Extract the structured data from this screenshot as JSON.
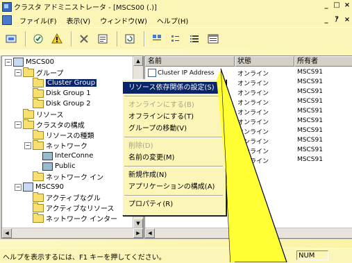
{
  "window": {
    "title": "クラスタ アドミニストレータ - [MSCS00 (.)]",
    "title_controls": [
      "_",
      "□",
      "×"
    ],
    "mdi_controls": [
      "_",
      "ｱ",
      "×"
    ]
  },
  "menubar": {
    "items": [
      "ファイル(F)",
      "表示(V)",
      "ウィンドウ(W)",
      "ヘルプ(H)"
    ]
  },
  "toolbar": {
    "buttons": [
      "connect-icon",
      "online-icon",
      "offline-icon",
      "delete-icon",
      "properties-icon",
      "refresh-icon",
      "large-icons-icon",
      "small-icons-icon",
      "list-view-icon",
      "details-view-icon"
    ]
  },
  "tree": {
    "items": [
      {
        "label": "MSCS00",
        "indent": 0,
        "icon": "cluster-icon",
        "expander": "−"
      },
      {
        "label": "グループ",
        "indent": 1,
        "icon": "folder-icon",
        "expander": "−"
      },
      {
        "label": "Cluster Group",
        "indent": 2,
        "icon": "folder-icon",
        "expander": "",
        "selected": true
      },
      {
        "label": "Disk Group 1",
        "indent": 2,
        "icon": "folder-icon",
        "expander": ""
      },
      {
        "label": "Disk Group 2",
        "indent": 2,
        "icon": "folder-icon",
        "expander": ""
      },
      {
        "label": "リソース",
        "indent": 1,
        "icon": "folder-icon",
        "expander": ""
      },
      {
        "label": "クラスタの構成",
        "indent": 1,
        "icon": "folder-icon",
        "expander": "−"
      },
      {
        "label": "リソースの種類",
        "indent": 2,
        "icon": "folder-icon",
        "expander": ""
      },
      {
        "label": "ネットワーク",
        "indent": 2,
        "icon": "folder-icon",
        "expander": "−"
      },
      {
        "label": "InterConne",
        "indent": 3,
        "icon": "network-icon",
        "expander": ""
      },
      {
        "label": "Public",
        "indent": 3,
        "icon": "network-icon",
        "expander": ""
      },
      {
        "label": "ネットワーク イン",
        "indent": 2,
        "icon": "folder-icon",
        "expander": ""
      },
      {
        "label": "MSCS90",
        "indent": 1,
        "icon": "server-icon",
        "expander": "−"
      },
      {
        "label": "アクティブなグル",
        "indent": 2,
        "icon": "folder-icon",
        "expander": ""
      },
      {
        "label": "アクティブなリソース",
        "indent": 2,
        "icon": "folder-icon",
        "expander": ""
      },
      {
        "label": "ネットワーク インター",
        "indent": 2,
        "icon": "folder-icon",
        "expander": ""
      }
    ]
  },
  "list": {
    "columns": [
      "名前",
      "状態",
      "所有者"
    ],
    "rows": [
      {
        "name": "Cluster IP Address",
        "state": "オンライン",
        "owner": "MSCS91"
      },
      {
        "name": "",
        "state": "オンライン",
        "owner": "MSCS91"
      },
      {
        "name": "",
        "state": "オンライン",
        "owner": "MSCS91"
      },
      {
        "name": "",
        "state": "オンライン",
        "owner": "MSCS91"
      },
      {
        "name": "",
        "state": "オンライン",
        "owner": "MSCS91"
      },
      {
        "name": "",
        "state": "オンライン",
        "owner": "MSCS91"
      },
      {
        "name": "",
        "state": "オンライン",
        "owner": "MSCS91"
      },
      {
        "name": "",
        "state": "オンライン",
        "owner": "MSCS91"
      },
      {
        "name": "",
        "state": "オンライン",
        "owner": "MSCS91"
      },
      {
        "name": "",
        "state": "オンライン",
        "owner": "MSCS91"
      }
    ]
  },
  "context_menu": {
    "items": [
      {
        "label": "リソース依存関係の設定(S)",
        "state": "highlighted"
      },
      {
        "sep": true
      },
      {
        "label": "オンラインにする(B)",
        "state": "disabled"
      },
      {
        "label": "オフラインにする(T)",
        "state": "normal"
      },
      {
        "label": "グループの移動(V)",
        "state": "normal"
      },
      {
        "sep": true
      },
      {
        "label": "削除(D)",
        "state": "disabled"
      },
      {
        "label": "名前の変更(M)",
        "state": "normal"
      },
      {
        "sep": true
      },
      {
        "label": "新規作成(N)",
        "state": "normal"
      },
      {
        "label": "アプリケーションの構成(A)",
        "state": "normal"
      },
      {
        "sep": true
      },
      {
        "label": "プロパティ(R)",
        "state": "normal"
      }
    ]
  },
  "statusbar": {
    "text": "ヘルプを表示するには、F1 キーを押してください。",
    "num": "NUM"
  },
  "colors": {
    "callout_fill": "#ffff33",
    "selection": "#0a246a",
    "window_bg": "#fbf6b8"
  }
}
